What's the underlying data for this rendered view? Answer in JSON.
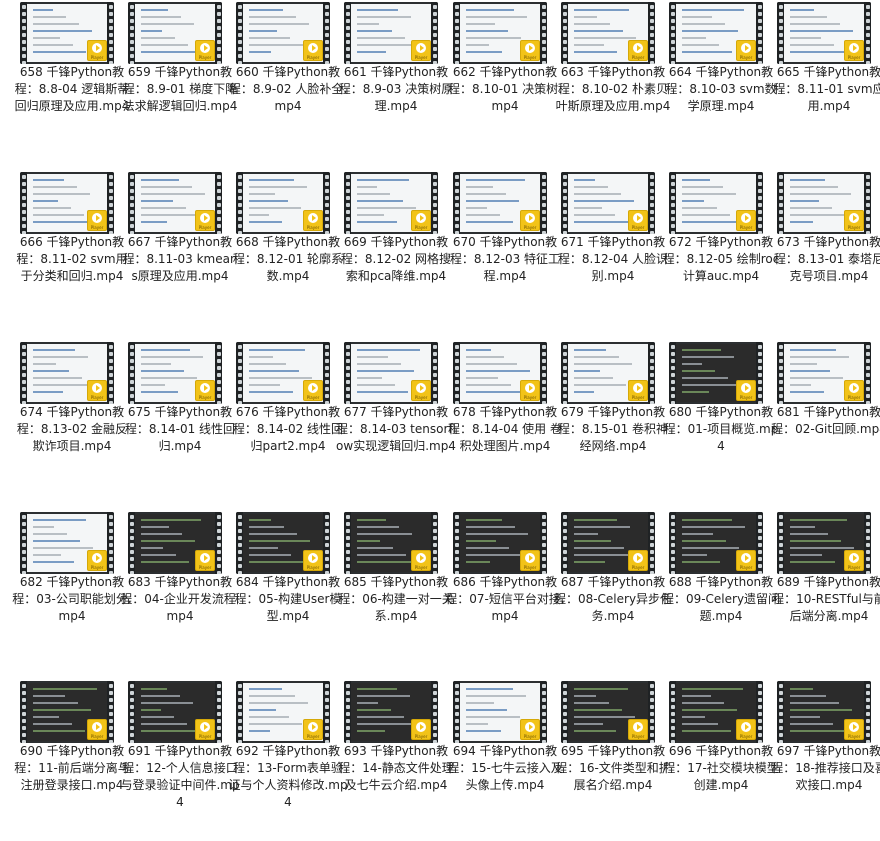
{
  "play_badge": {
    "label": "Player",
    "color": "#f2c318",
    "icon": "play-icon"
  },
  "files": [
    {
      "caption": "658 千锋Python教程：8.8-04 逻辑斯蒂回归原理及应用.mp4",
      "theme": "light"
    },
    {
      "caption": "659 千锋Python教程：8.9-01 梯度下降法求解逻辑回归.mp4",
      "theme": "light"
    },
    {
      "caption": "660 千锋Python教程：8.9-02 人脸补全.mp4",
      "theme": "light"
    },
    {
      "caption": "661 千锋Python教程：8.9-03 决策树原理.mp4",
      "theme": "light"
    },
    {
      "caption": "662 千锋Python教程：8.10-01 决策树.mp4",
      "theme": "light"
    },
    {
      "caption": "663 千锋Python教程：8.10-02 朴素贝叶斯原理及应用.mp4",
      "theme": "light"
    },
    {
      "caption": "664 千锋Python教程：8.10-03 svm数学原理.mp4",
      "theme": "light"
    },
    {
      "caption": "665 千锋Python教程：8.11-01 svm应用.mp4",
      "theme": "light"
    },
    {
      "caption": "666 千锋Python教程：8.11-02 svm用于分类和回归.mp4",
      "theme": "light"
    },
    {
      "caption": "667 千锋Python教程：8.11-03 kmeans原理及应用.mp4",
      "theme": "light"
    },
    {
      "caption": "668 千锋Python教程：8.12-01 轮廓系数.mp4",
      "theme": "light"
    },
    {
      "caption": "669 千锋Python教程：8.12-02 网格搜索和pca降维.mp4",
      "theme": "light"
    },
    {
      "caption": "670 千锋Python教程：8.12-03 特征工程.mp4",
      "theme": "light"
    },
    {
      "caption": "671 千锋Python教程：8.12-04 人脸识别.mp4",
      "theme": "light"
    },
    {
      "caption": "672 千锋Python教程：8.12-05 绘制roc计算auc.mp4",
      "theme": "light"
    },
    {
      "caption": "673 千锋Python教程：8.13-01 泰塔尼克号项目.mp4",
      "theme": "light"
    },
    {
      "caption": "674 千锋Python教程：8.13-02 金融反欺诈项目.mp4",
      "theme": "light"
    },
    {
      "caption": "675 千锋Python教程：8.14-01 线性回归.mp4",
      "theme": "light"
    },
    {
      "caption": "676 千锋Python教程：8.14-02 线性回归part2.mp4",
      "theme": "light"
    },
    {
      "caption": "677 千锋Python教程：8.14-03 tensorflow实现逻辑回归.mp4",
      "theme": "light"
    },
    {
      "caption": "678 千锋Python教程：8.14-04 使用 卷积处理图片.mp4",
      "theme": "light"
    },
    {
      "caption": "679 千锋Python教程：8.15-01 卷积神经网络.mp4",
      "theme": "light"
    },
    {
      "caption": "680 千锋Python教程：01-项目概览.mp4",
      "theme": "dark"
    },
    {
      "caption": "681 千锋Python教程：02-Git回顾.mp4",
      "theme": "light"
    },
    {
      "caption": "682 千锋Python教程：03-公司职能划分.mp4",
      "theme": "light"
    },
    {
      "caption": "683 千锋Python教程：04-企业开发流程.mp4",
      "theme": "dark"
    },
    {
      "caption": "684 千锋Python教程：05-构建User模型.mp4",
      "theme": "dark"
    },
    {
      "caption": "685 千锋Python教程：06-构建一对一关系.mp4",
      "theme": "dark"
    },
    {
      "caption": "686 千锋Python教程：07-短信平台对接.mp4",
      "theme": "dark"
    },
    {
      "caption": "687 千锋Python教程：08-Celery异步任务.mp4",
      "theme": "dark"
    },
    {
      "caption": "688 千锋Python教程：09-Celery遗留问题.mp4",
      "theme": "dark"
    },
    {
      "caption": "689 千锋Python教程：10-RESTful与前后端分离.mp4",
      "theme": "dark"
    },
    {
      "caption": "690 千锋Python教程：11-前后端分离与注册登录接口.mp4",
      "theme": "dark"
    },
    {
      "caption": "691 千锋Python教程：12-个人信息接口与登录验证中间件.mp4",
      "theme": "dark"
    },
    {
      "caption": "692 千锋Python教程：13-Form表单验证与个人资料修改.mp4",
      "theme": "light"
    },
    {
      "caption": "693 千锋Python教程：14-静态文件处理及七牛云介绍.mp4",
      "theme": "dark"
    },
    {
      "caption": "694 千锋Python教程：15-七牛云接入及头像上传.mp4",
      "theme": "light"
    },
    {
      "caption": "695 千锋Python教程：16-文件类型和扩展名介绍.mp4",
      "theme": "dark"
    },
    {
      "caption": "696 千锋Python教程：17-社交模块模型创建.mp4",
      "theme": "dark"
    },
    {
      "caption": "697 千锋Python教程：18-推荐接口及喜欢接口.mp4",
      "theme": "dark"
    }
  ]
}
